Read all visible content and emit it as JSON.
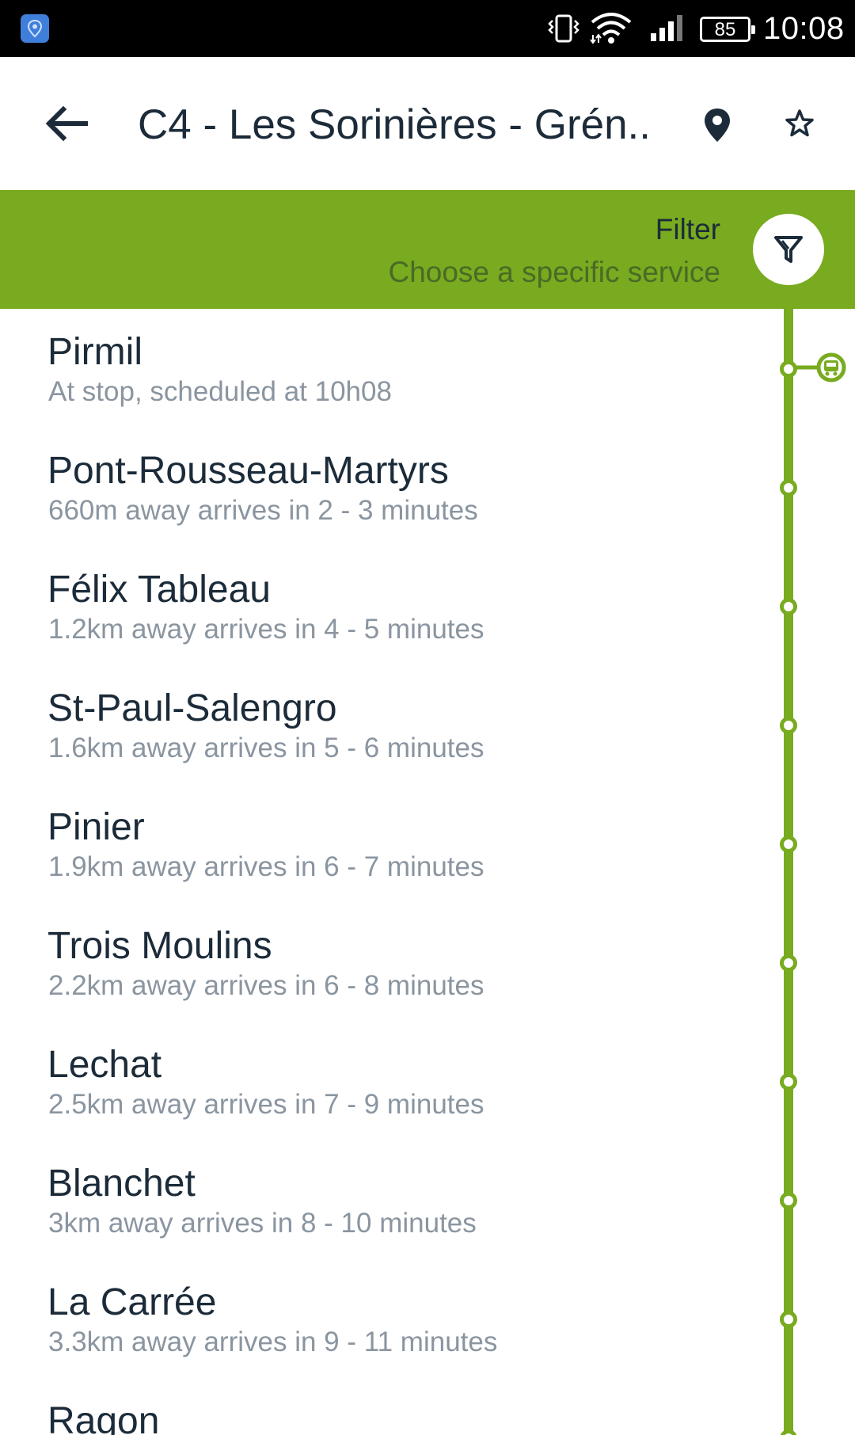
{
  "status_bar": {
    "battery": "85",
    "time": "10:08"
  },
  "header": {
    "title": "C4 - Les Sorinières - Grén..."
  },
  "filter": {
    "label": "Filter",
    "subtitle": "Choose a specific service"
  },
  "colors": {
    "accent": "#78ab1f",
    "text_primary": "#1c2b39",
    "text_secondary": "#8a95a0",
    "status_bar": "#000000"
  },
  "icons": {
    "back": "arrow-left-icon",
    "location": "map-pin-icon",
    "favorite": "star-outline-icon",
    "filter": "filter-funnel-icon",
    "bus": "bus-icon"
  },
  "stops": [
    {
      "name": "Pirmil",
      "info": "At stop, scheduled at 10h08",
      "bus_here": true
    },
    {
      "name": "Pont-Rousseau-Martyrs",
      "info": "660m away arrives in 2 - 3 minutes",
      "bus_here": false
    },
    {
      "name": "Félix Tableau",
      "info": "1.2km away arrives in 4 - 5 minutes",
      "bus_here": false
    },
    {
      "name": "St-Paul-Salengro",
      "info": "1.6km away arrives in 5 - 6 minutes",
      "bus_here": false
    },
    {
      "name": "Pinier",
      "info": "1.9km away arrives in 6 - 7 minutes",
      "bus_here": false
    },
    {
      "name": "Trois Moulins",
      "info": "2.2km away arrives in 6 - 8 minutes",
      "bus_here": false
    },
    {
      "name": "Lechat",
      "info": "2.5km away arrives in 7 - 9 minutes",
      "bus_here": false
    },
    {
      "name": "Blanchet",
      "info": "3km away arrives in 8 - 10 minutes",
      "bus_here": false
    },
    {
      "name": "La Carrée",
      "info": "3.3km away arrives in 9 - 11 minutes",
      "bus_here": false
    },
    {
      "name": "Ragon",
      "info": "",
      "bus_here": false
    }
  ]
}
